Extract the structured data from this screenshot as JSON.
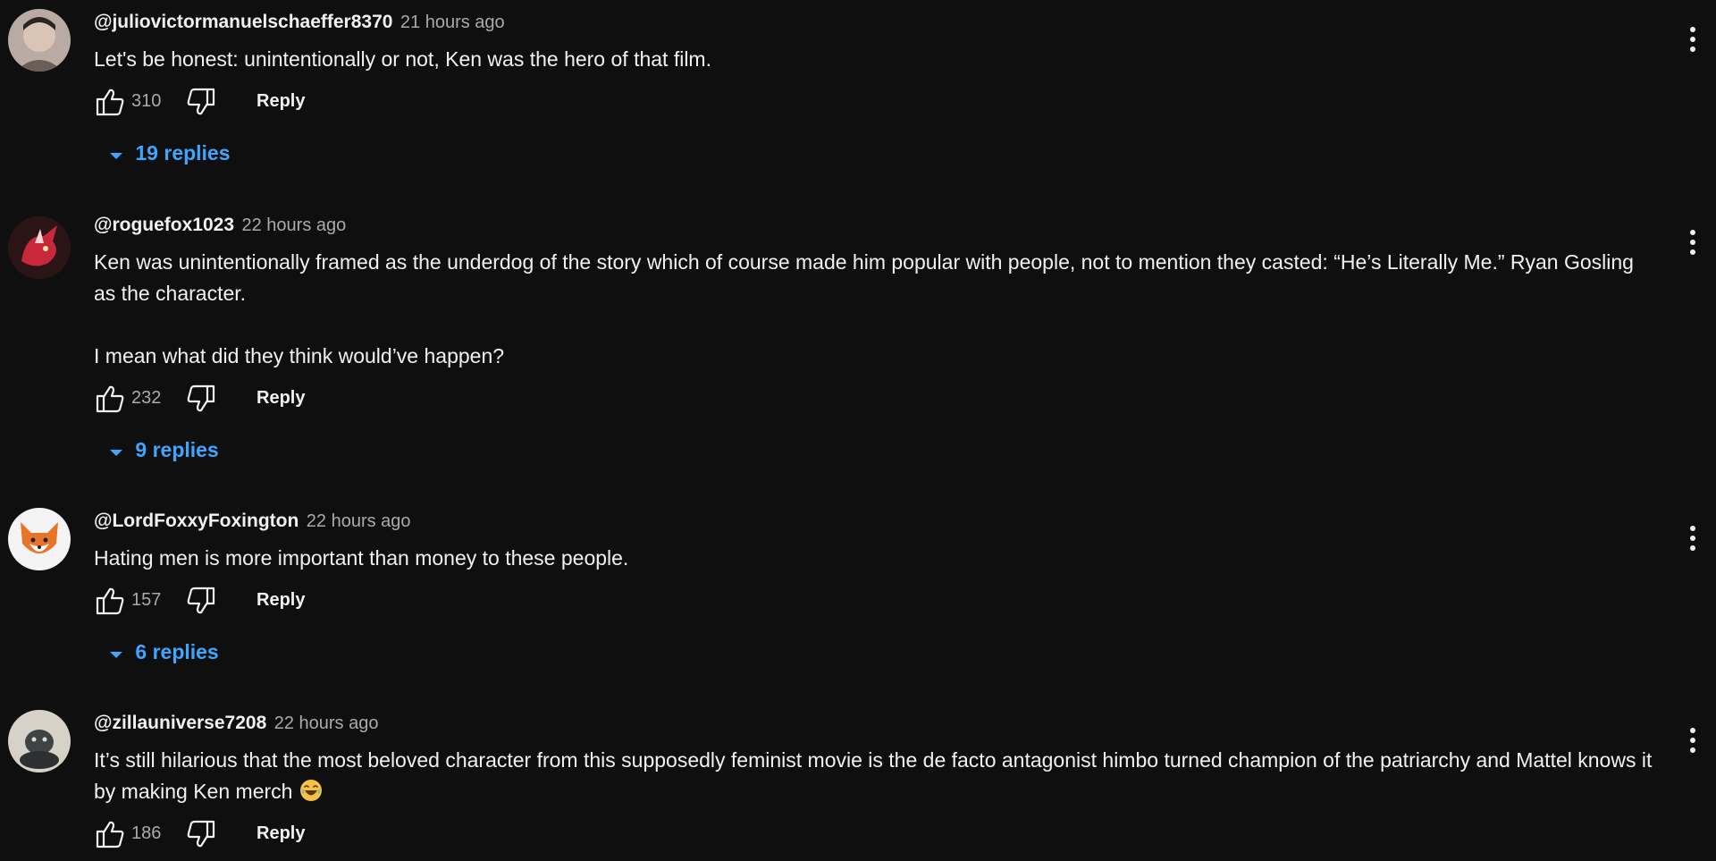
{
  "comments": [
    {
      "author": "@juliovictormanuelschaeffer8370",
      "time": "21 hours ago",
      "text": "Let's be honest: unintentionally or not, Ken was the hero of that film.",
      "likes": "310",
      "reply_label": "Reply",
      "replies_label": "19 replies",
      "avatar_icon": "person-photo-avatar"
    },
    {
      "author": "@roguefox1023",
      "time": "22 hours ago",
      "text": "Ken was unintentionally framed as the underdog of the story which of course made him popular with people, not to mention they casted: “He’s Literally Me.” Ryan Gosling as the character.\n\nI mean what did they think would’ve happen?",
      "likes": "232",
      "reply_label": "Reply",
      "replies_label": "9 replies",
      "avatar_icon": "red-fox-avatar"
    },
    {
      "author": "@LordFoxxyFoxington",
      "time": "22 hours ago",
      "text": "Hating men is more important than money to these people.",
      "likes": "157",
      "reply_label": "Reply",
      "replies_label": "6 replies",
      "avatar_icon": "cartoon-fox-avatar"
    },
    {
      "author": "@zillauniverse7208",
      "time": "22 hours ago",
      "text": "It’s still hilarious that the most beloved character from this supposedly feminist movie is the de facto antagonist himbo turned champion of the patriarchy and Mattel knows it by making Ken merch",
      "emoji": "laughing-tears-emoji",
      "likes": "186",
      "reply_label": "Reply",
      "avatar_icon": "godzilla-figure-avatar"
    }
  ],
  "colors": {
    "background": "#0f0f0f",
    "text": "#f1f1f1",
    "secondary_text": "#aaaaaa",
    "link": "#3ea6ff"
  }
}
